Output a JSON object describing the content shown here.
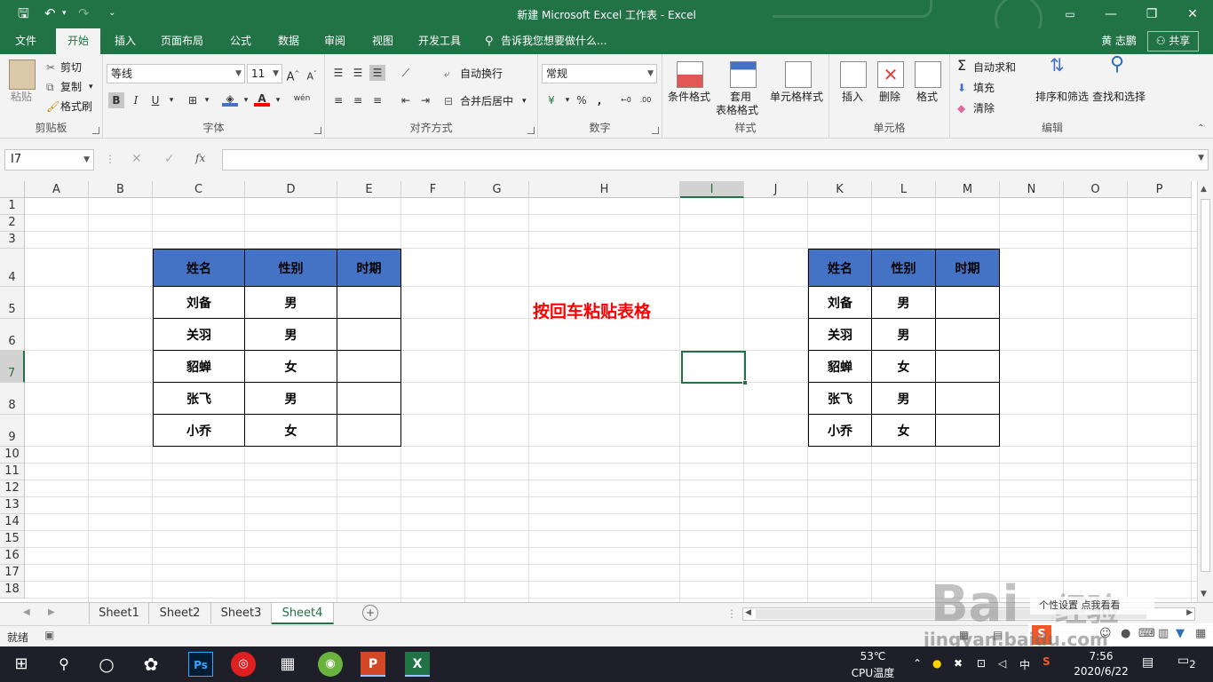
{
  "window": {
    "title": "新建 Microsoft Excel 工作表 - Excel",
    "user": "黄 志鹏",
    "share": "共享"
  },
  "tabs": [
    "文件",
    "开始",
    "插入",
    "页面布局",
    "公式",
    "数据",
    "审阅",
    "视图",
    "开发工具"
  ],
  "tell_me": "告诉我您想要做什么...",
  "ribbon": {
    "clipboard": {
      "paste": "粘贴",
      "cut": "剪切",
      "copy": "复制",
      "format_painter": "格式刷",
      "label": "剪贴板"
    },
    "font": {
      "name": "等线",
      "size": "11",
      "bold": "B",
      "italic": "I",
      "underline": "U",
      "wen": "wén",
      "label": "字体"
    },
    "alignment": {
      "wrap": "自动换行",
      "merge": "合并后居中",
      "label": "对齐方式"
    },
    "number": {
      "format": "常规",
      "percent": "%",
      "comma": ",",
      "label": "数字"
    },
    "styles": {
      "cond": "条件格式",
      "table": "套用",
      "table2": "表格格式",
      "cell": "单元格样式",
      "label": "样式"
    },
    "cells": {
      "insert": "插入",
      "delete": "删除",
      "format": "格式",
      "label": "单元格"
    },
    "editing": {
      "autosum": "自动求和",
      "fill": "填充",
      "clear": "清除",
      "sort": "排序和筛选",
      "find": "查找和选择",
      "label": "编辑"
    }
  },
  "formula_bar": {
    "name_box": "I7",
    "fx": "fx",
    "value": ""
  },
  "columns": [
    "A",
    "B",
    "C",
    "D",
    "E",
    "F",
    "G",
    "H",
    "I",
    "J",
    "K",
    "L",
    "M",
    "N",
    "O",
    "P"
  ],
  "rows": [
    "1",
    "2",
    "3",
    "4",
    "5",
    "6",
    "7",
    "8",
    "9",
    "10",
    "11",
    "12",
    "13",
    "14",
    "15",
    "16",
    "17",
    "18"
  ],
  "table_left": {
    "headers": [
      "姓名",
      "性别",
      "时期"
    ],
    "rows": [
      [
        "刘备",
        "男",
        ""
      ],
      [
        "关羽",
        "男",
        ""
      ],
      [
        "貂蝉",
        "女",
        ""
      ],
      [
        "张飞",
        "男",
        ""
      ],
      [
        "小乔",
        "女",
        ""
      ]
    ]
  },
  "table_right": {
    "headers": [
      "姓名",
      "性别",
      "时期"
    ],
    "rows": [
      [
        "刘备",
        "男",
        ""
      ],
      [
        "关羽",
        "男",
        ""
      ],
      [
        "貂蝉",
        "女",
        ""
      ],
      [
        "张飞",
        "男",
        ""
      ],
      [
        "小乔",
        "女",
        ""
      ]
    ]
  },
  "note": "按回车粘贴表格",
  "sheets": [
    "Sheet1",
    "Sheet2",
    "Sheet3",
    "Sheet4"
  ],
  "status": {
    "ready": "就绪"
  },
  "taskbar": {
    "temp": "53℃",
    "temp_label": "CPU温度",
    "ime": "中",
    "time": "7:56",
    "date": "2020/6/22",
    "notif": "2"
  },
  "watermark": {
    "brand": "Bai",
    "brand2": "经验",
    "url": "jingyan.baidu.com",
    "overlay": "个性设置 点我看看"
  },
  "colors": {
    "excel_green": "#217346",
    "table_header": "#4472c4",
    "note_red": "#ff0000"
  }
}
